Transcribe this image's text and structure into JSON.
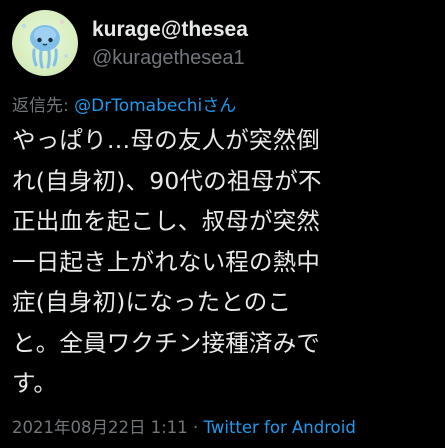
{
  "author": {
    "display_name": "kurage@thesea",
    "handle": "@kuragethesea1",
    "avatar_icon": "jellyfish-avatar-icon"
  },
  "reply": {
    "prefix": "返信先: ",
    "mention": "@DrTomabechiさん"
  },
  "tweet": {
    "lines": [
      "やっぱり…母の友人が突然倒",
      "れ(自身初)、90代の祖母が不",
      "正出血を起こし、叔母が突然",
      "一日起き上がれない程の熱中",
      "症(自身初)になったとのこ",
      "と。全員ワクチン接種済みで",
      "す。"
    ]
  },
  "meta": {
    "timestamp": "2021年08月22日 1:11 · ",
    "source": "Twitter for Android"
  },
  "colors": {
    "background": "#000000",
    "text": "#e7e9ea",
    "muted": "#71767b",
    "link": "#1d9bf0"
  }
}
